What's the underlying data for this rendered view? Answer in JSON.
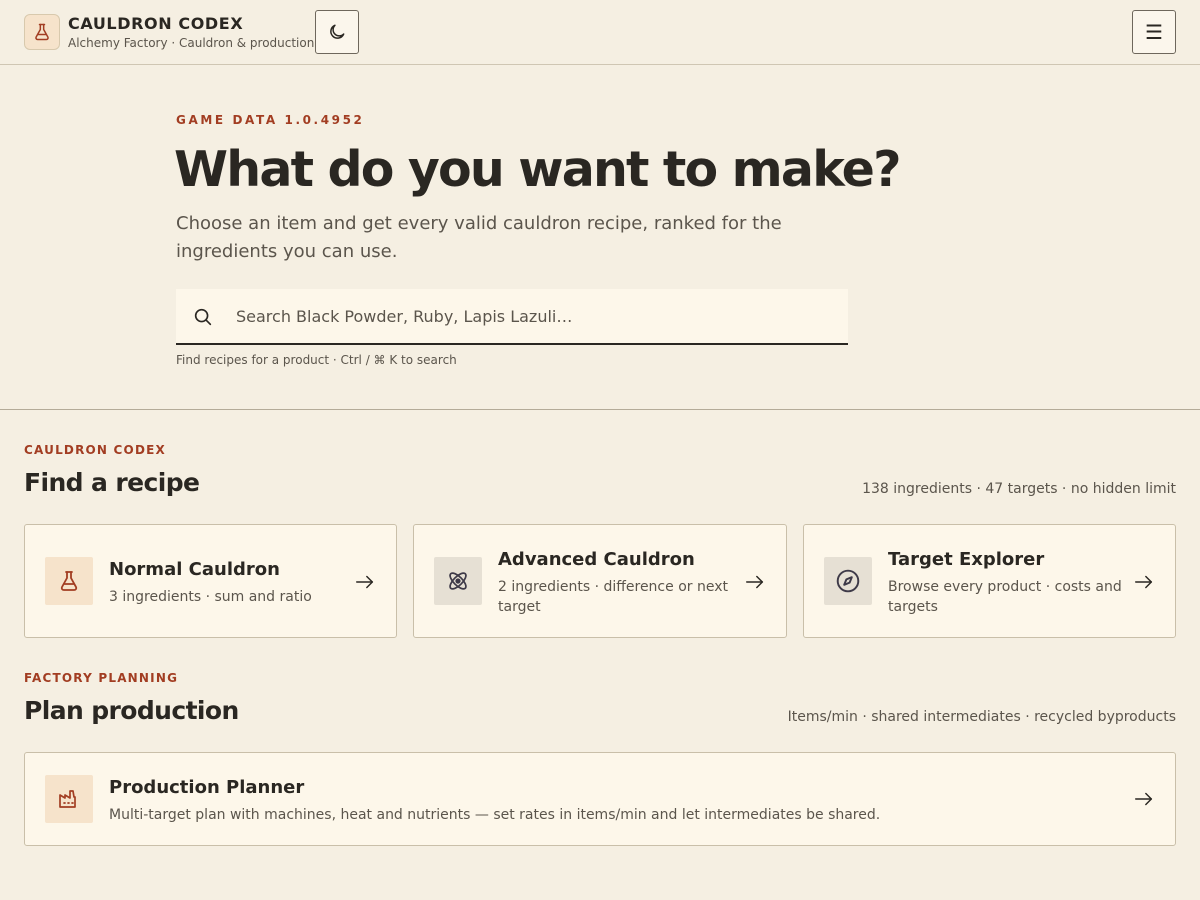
{
  "header": {
    "title": "CAULDRON CODEX",
    "subtitle": "Alchemy Factory · Cauldron & production",
    "logo_icon": "flask-icon",
    "theme_toggle_icon": "moon-icon",
    "menu_icon": "hamburger-menu-icon",
    "menu_glyph": "☰"
  },
  "hero": {
    "eyebrow": "GAME DATA 1.0.4952",
    "title": "What do you want to make?",
    "lead": "Choose an item and get every valid cauldron recipe, ranked for the ingredients you can use.",
    "search": {
      "placeholder": "Search Black Powder, Ruby, Lapis Lazuli…",
      "value": "",
      "icon": "search-icon"
    },
    "hint": "Find recipes for a product · Ctrl / ⌘ K to search"
  },
  "recipes_section": {
    "eyebrow": "CAULDRON CODEX",
    "title": "Find a recipe",
    "meta": "138 ingredients · 47 targets · no hidden limit",
    "cards": [
      {
        "title": "Normal Cauldron",
        "desc": "3 ingredients · sum and ratio",
        "icon": "flask-icon"
      },
      {
        "title": "Advanced Cauldron",
        "desc": "2 ingredients · difference or next target",
        "icon": "atom-icon"
      },
      {
        "title": "Target Explorer",
        "desc": "Browse every product · costs and targets",
        "icon": "compass-icon"
      }
    ]
  },
  "planning_section": {
    "eyebrow": "FACTORY PLANNING",
    "title": "Plan production",
    "meta": "Items/min · shared intermediates · recycled byproducts",
    "card": {
      "title": "Production Planner",
      "desc": "Multi-target plan with machines, heat and nutrients — set rates in items/min and let intermediates be shared.",
      "icon": "factory-icon"
    }
  },
  "colors": {
    "background": "#f5efe2",
    "accent": "#a23d22",
    "card": "#fdf7ea",
    "text": "#2a2722",
    "muted": "#5b554c"
  }
}
